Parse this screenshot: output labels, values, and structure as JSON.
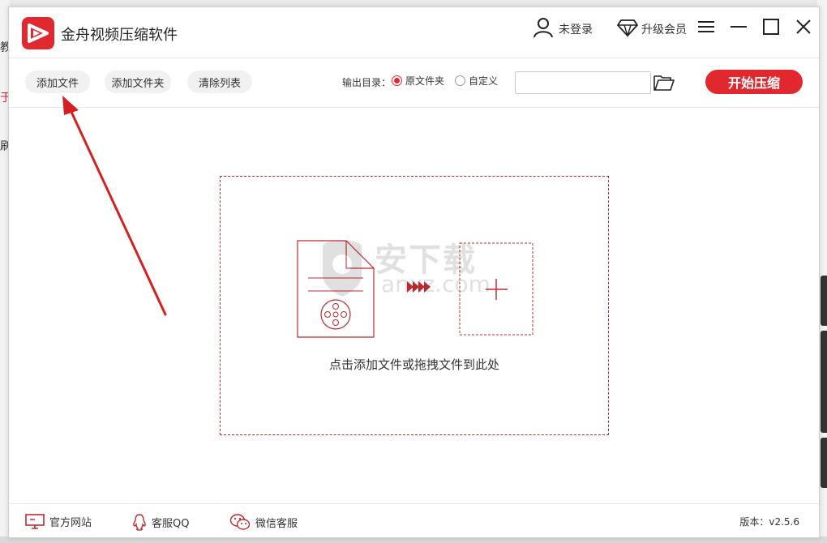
{
  "app": {
    "title": "金舟视频压缩软件"
  },
  "header": {
    "login_label": "未登录",
    "vip_label": "升级会员"
  },
  "toolbar": {
    "add_file": "添加文件",
    "add_folder": "添加文件夹",
    "clear_list": "清除列表",
    "output_label": "输出目录：",
    "output_options": [
      "原文件夹",
      "自定义"
    ],
    "output_selected": "原文件夹",
    "path_value": "",
    "start_button": "开始压缩"
  },
  "dropzone": {
    "hint": "点击添加文件或拖拽文件到此处"
  },
  "watermark": {
    "line1": "安下载",
    "line2": "anxz.com"
  },
  "footer": {
    "website": "官方网站",
    "qq": "客服QQ",
    "wechat": "微信客服",
    "version": "版本：v2.5.6"
  },
  "background": {
    "fragments": [
      "教",
      "于",
      "刷"
    ]
  },
  "colors": {
    "accent": "#e0282e",
    "annotation_arrow": "#d42020"
  }
}
